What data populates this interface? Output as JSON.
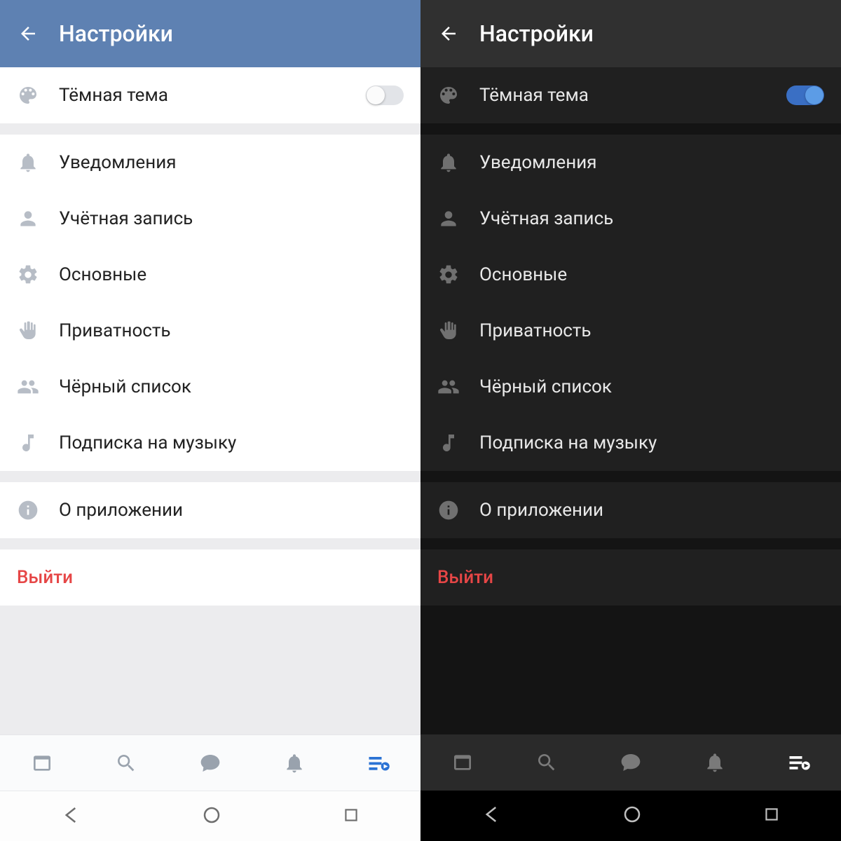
{
  "header": {
    "title": "Настройки"
  },
  "dark_theme": {
    "label": "Тёмная тема"
  },
  "items": {
    "notifications": "Уведомления",
    "account": "Учётная запись",
    "general": "Основные",
    "privacy": "Приватность",
    "blacklist": "Чёрный список",
    "music": "Подписка на музыку",
    "about": "О приложении"
  },
  "logout": "Выйти",
  "colors": {
    "light_header": "#5e81b2",
    "dark_header": "#303030",
    "accent": "#2a72d4",
    "danger": "#e64646"
  }
}
